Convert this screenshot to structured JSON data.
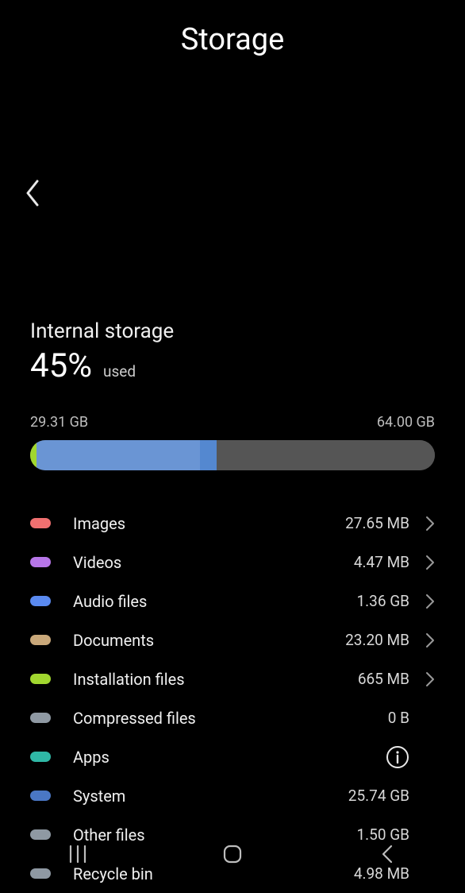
{
  "header": {
    "title": "Storage"
  },
  "storage": {
    "section_title": "Internal storage",
    "percent": "45%",
    "used_label": "used",
    "used_size": "29.31 GB",
    "total_size": "64.00 GB"
  },
  "bar_segments": [
    {
      "color": "#a1d72f",
      "width": 1.5
    },
    {
      "color": "#6a95d4",
      "width": 40.5
    },
    {
      "color": "#5488d0",
      "width": 4
    },
    {
      "color": "#555555",
      "width": 54
    }
  ],
  "categories": [
    {
      "label": "Images",
      "size": "27.65 MB",
      "color": "#f07070",
      "chevron": true,
      "info": false
    },
    {
      "label": "Videos",
      "size": "4.47 MB",
      "color": "#b776e8",
      "chevron": true,
      "info": false
    },
    {
      "label": "Audio files",
      "size": "1.36 GB",
      "color": "#5a8af0",
      "chevron": true,
      "info": false
    },
    {
      "label": "Documents",
      "size": "23.20 MB",
      "color": "#c9a87a",
      "chevron": true,
      "info": false
    },
    {
      "label": "Installation files",
      "size": "665 MB",
      "color": "#a1d72f",
      "chevron": true,
      "info": false
    },
    {
      "label": "Compressed files",
      "size": "0 B",
      "color": "#8f99a3",
      "chevron": false,
      "info": false
    },
    {
      "label": "Apps",
      "size": "",
      "color": "#2fb8a6",
      "chevron": false,
      "info": true
    },
    {
      "label": "System",
      "size": "25.74 GB",
      "color": "#4a77c4",
      "chevron": false,
      "info": false
    },
    {
      "label": "Other files",
      "size": "1.50 GB",
      "color": "#8f99a3",
      "chevron": false,
      "info": false
    },
    {
      "label": "Recycle bin",
      "size": "4.98 MB",
      "color": "#8f99a3",
      "chevron": false,
      "info": false
    }
  ]
}
